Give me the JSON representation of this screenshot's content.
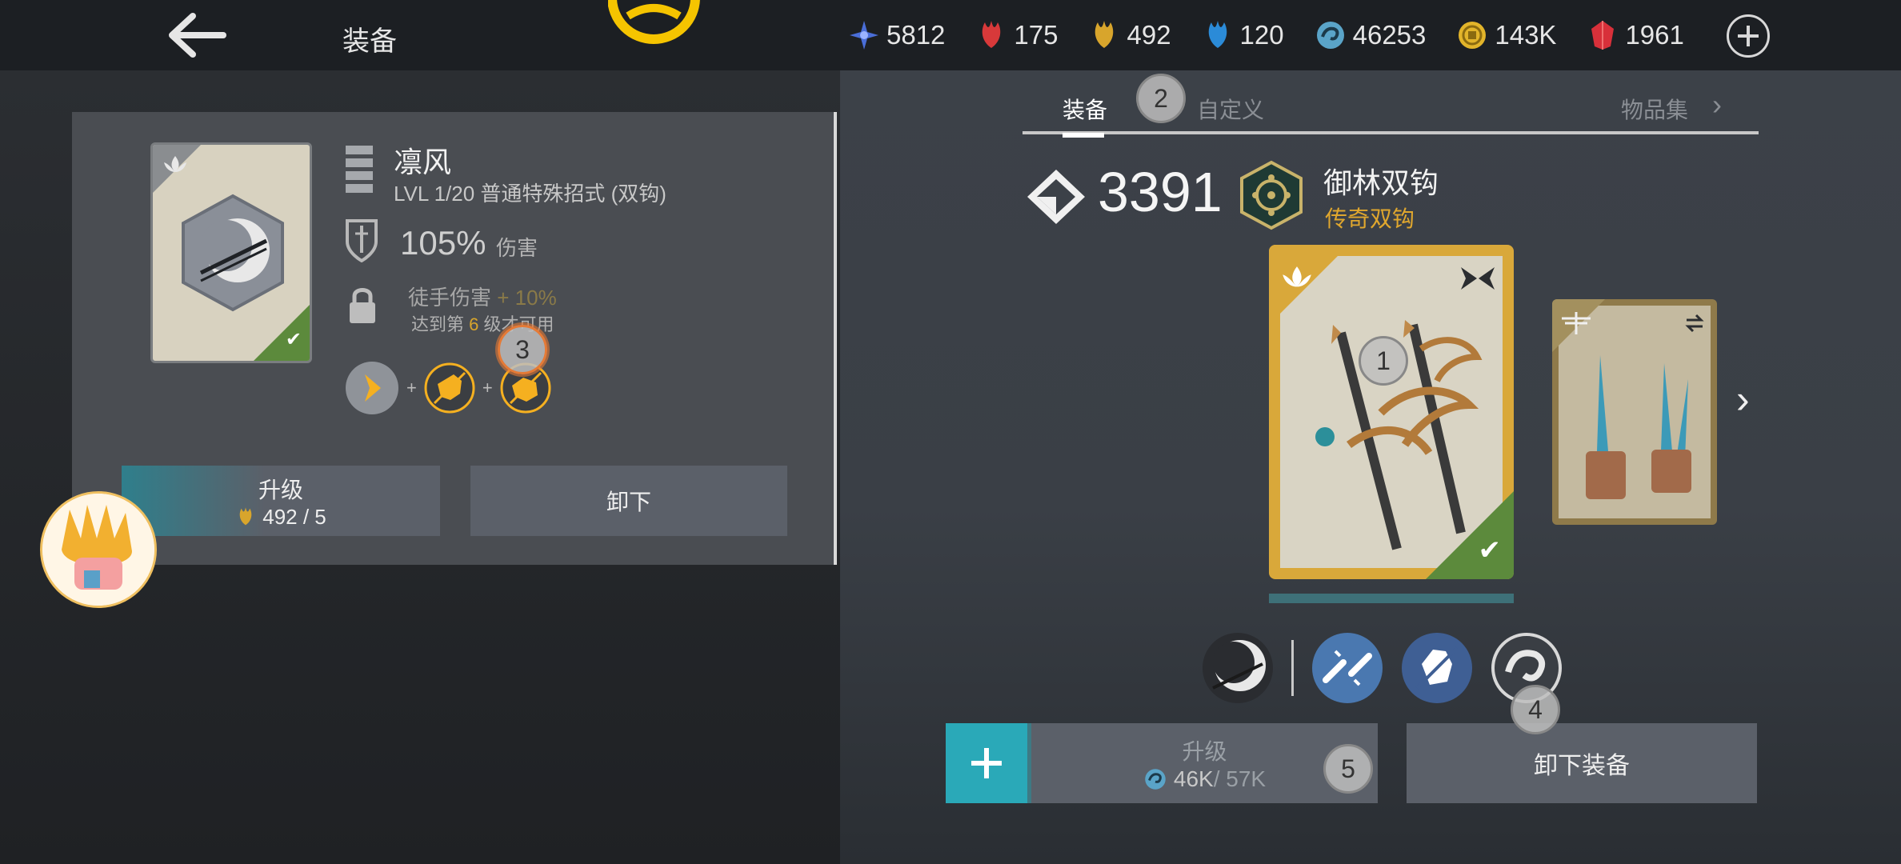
{
  "header": {
    "title": "装备",
    "currencies": [
      {
        "icon": "blue-star-shard-icon",
        "value": "5812",
        "color": "#4a6ed8"
      },
      {
        "icon": "red-leaf-icon",
        "value": "175",
        "color": "#d8393a"
      },
      {
        "icon": "gold-leaf-icon",
        "value": "492",
        "color": "#d8a52c"
      },
      {
        "icon": "blue-leaf-icon",
        "value": "120",
        "color": "#2b8bd8"
      },
      {
        "icon": "swirl-coin-icon",
        "value": "46253",
        "color": "#5aa4c8"
      },
      {
        "icon": "gold-coin-icon",
        "value": "143K",
        "color": "#e2b42a"
      },
      {
        "icon": "red-gem-icon",
        "value": "1961",
        "color": "#d8303a"
      }
    ]
  },
  "detail": {
    "name": "凛风",
    "level_line": "LVL  1/20  普通特殊招式 (双钩)",
    "damage_value": "105%",
    "damage_label": "伤害",
    "locked_bonus_text": "徒手伤害",
    "locked_bonus_value": "+ 10%",
    "unlock_pre": "达到第",
    "unlock_level": "6",
    "unlock_post": "级才可用",
    "combo_plus": "+",
    "upgrade_label": "升级",
    "upgrade_cost": "492 / 5",
    "unequip_label": "卸下"
  },
  "tabs": {
    "equip": "装备",
    "custom": "自定义",
    "collection": "物品集"
  },
  "weapon": {
    "gear_score": "3391",
    "name": "御林双钩",
    "rarity": "传奇双钩",
    "upgrade_label": "升级",
    "upgrade_have": "46K",
    "upgrade_need": " / 57K",
    "unequip_label": "卸下装备",
    "rarity_color": "#e0a72e"
  },
  "markers": [
    "1",
    "2",
    "3",
    "4",
    "5"
  ]
}
